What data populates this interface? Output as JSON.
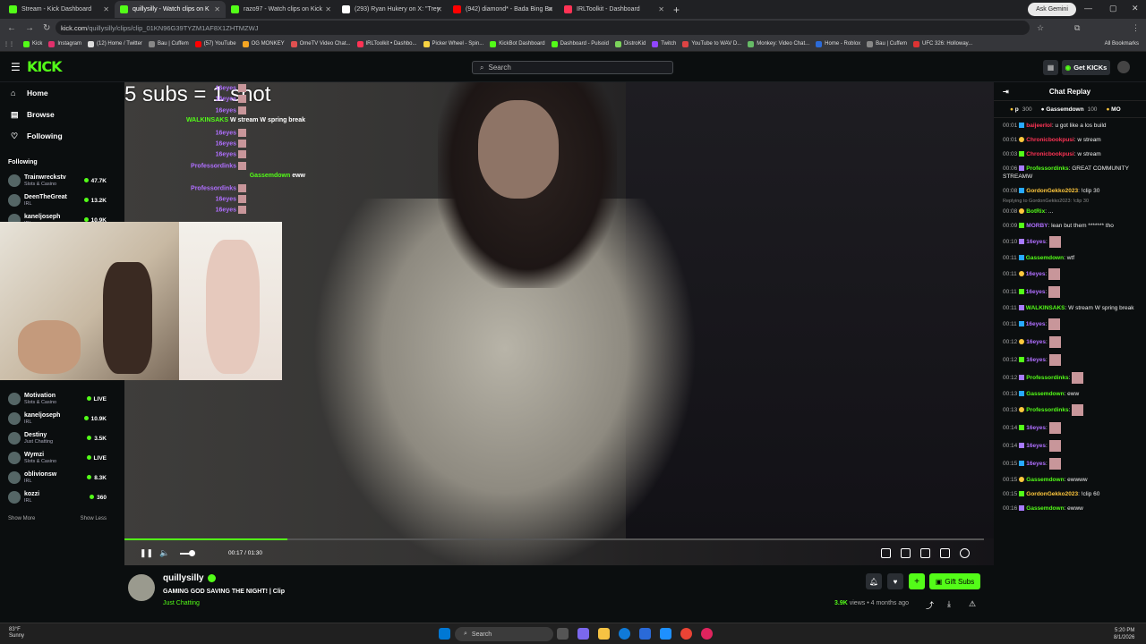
{
  "browser": {
    "tabs": [
      {
        "title": "Stream - Kick Dashboard",
        "color": "#53fc18",
        "active": false
      },
      {
        "title": "quillysilly - Watch clips on K",
        "color": "#53fc18",
        "active": true
      },
      {
        "title": "razo97 - Watch clips on Kick",
        "color": "#53fc18",
        "active": false
      },
      {
        "title": "(293) Ryan Hukery on X: \"Trey",
        "color": "#ffffff",
        "active": false
      },
      {
        "title": "(942) diamond* - Bada Bing Ba",
        "color": "#ff0000",
        "active": false
      },
      {
        "title": "IRLToolkit - Dashboard",
        "color": "#ff3355",
        "active": false
      }
    ],
    "ask_gemini": "Ask Gemini",
    "url_host": "kick.com",
    "url_path": "/quillysilly/clips/clip_01KN96G39TYZM1AF8X1ZHTMZWJ",
    "bookmarks": [
      "Kick",
      "Instagram",
      "(12) Home / Twitter",
      "Bau | Cuffem",
      "(57) YouTube",
      "OG MONKEY",
      "OmeTV Video Chat...",
      "IRLToolkit • Dashbo...",
      "Picker Wheel - Spin...",
      "KickBot Dashboard",
      "Dashboard - Pulsoid",
      "DistroKid",
      "Twitch",
      "YouTube to WAV D...",
      "Monkey: Video Chat...",
      "Home - Roblox",
      "Bau | Cuffem",
      "UFC 326: Holloway..."
    ],
    "all_bookmarks": "All Bookmarks"
  },
  "kick": {
    "logo": "KICK",
    "search_placeholder": "Search",
    "get_kicks": "Get KICKs",
    "nav": [
      {
        "label": "Home",
        "icon": "⌂"
      },
      {
        "label": "Browse",
        "icon": "▤"
      },
      {
        "label": "Following",
        "icon": "♡"
      }
    ],
    "following_heading": "Following",
    "channels": [
      {
        "name": "Trainwreckstv",
        "cat": "Slots & Casino",
        "viewers": "47.7K"
      },
      {
        "name": "DeenTheGreat",
        "cat": "IRL",
        "viewers": "13.2K"
      },
      {
        "name": "kaneljoseph",
        "cat": "IRL",
        "viewers": "10.9K"
      }
    ],
    "channels_lower": [
      {
        "name": "Motivation",
        "cat": "Slots & Casino",
        "viewers": "LIVE"
      },
      {
        "name": "kaneljoseph",
        "cat": "IRL",
        "viewers": "10.9K"
      },
      {
        "name": "Destiny",
        "cat": "Just Chatting",
        "viewers": "3.5K"
      },
      {
        "name": "Wymzi",
        "cat": "Slots & Casino",
        "viewers": "LIVE"
      },
      {
        "name": "oblivionsw",
        "cat": "IRL",
        "viewers": "8.3K"
      },
      {
        "name": "kozzi",
        "cat": "IRL",
        "viewers": "360"
      }
    ],
    "show_more": "Show More",
    "show_less": "Show Less"
  },
  "player": {
    "overlay_title": "5 subs = 1 shot",
    "overlay_chat": [
      {
        "user": "16eyes",
        "text": "",
        "green": false
      },
      {
        "user": "16eyes",
        "text": "",
        "green": false
      },
      {
        "user": "16eyes",
        "text": "",
        "green": false
      },
      {
        "user": "WALKINSAKS",
        "text": "W stream W spring break",
        "green": true
      },
      {
        "user": "16eyes",
        "text": "",
        "green": false
      },
      {
        "user": "16eyes",
        "text": "",
        "green": false
      },
      {
        "user": "16eyes",
        "text": "",
        "green": false
      },
      {
        "user": "Professordinks",
        "text": "",
        "green": false
      },
      {
        "user": "Gassemdown",
        "text": "eww",
        "green": true
      },
      {
        "user": "Professordinks",
        "text": "",
        "green": false
      },
      {
        "user": "16eyes",
        "text": "",
        "green": false
      },
      {
        "user": "16eyes",
        "text": "",
        "green": false
      }
    ],
    "time_current": "00:17",
    "time_total": "01:30",
    "progress": 0.19
  },
  "chat": {
    "title": "Chat Replay",
    "pinned": [
      {
        "label": "p",
        "value": "300"
      },
      {
        "label": "Gassemdown",
        "value": "100"
      },
      {
        "label": "MO",
        "value": ""
      }
    ],
    "messages": [
      {
        "t": "00:01",
        "user": "baijeerIol",
        "color": "#ff3355",
        "text": "u got like a los build",
        "emote": false
      },
      {
        "t": "00:01",
        "user": "Chronicbookpusi",
        "color": "#ff3355",
        "text": "w stream",
        "emote": false
      },
      {
        "t": "00:03",
        "user": "Chronicbookpusi",
        "color": "#ff3355",
        "text": "w stream",
        "emote": false
      },
      {
        "t": "00:06",
        "user": "Professordinks",
        "color": "#53fc18",
        "text": "GREAT COMMUNITY STREAMW",
        "emote": false
      },
      {
        "t": "00:08",
        "user": "GordonGekko2023",
        "color": "#ffc83d",
        "text": "!clip 30",
        "emote": false
      },
      {
        "t": "00:08",
        "user": "BotRix",
        "color": "#53fc18",
        "text": "...",
        "emote": false,
        "reply": "Replying to GordonGekko2023: !clip 30"
      },
      {
        "t": "00:09",
        "user": "MORBY",
        "color": "#b06fff",
        "text": "lean but them ******* tho",
        "emote": false
      },
      {
        "t": "00:10",
        "user": "16eyes",
        "color": "#b06fff",
        "text": "",
        "emote": true
      },
      {
        "t": "00:11",
        "user": "Gassemdown",
        "color": "#53fc18",
        "text": "wtf",
        "emote": false
      },
      {
        "t": "00:11",
        "user": "16eyes",
        "color": "#b06fff",
        "text": "",
        "emote": true
      },
      {
        "t": "00:11",
        "user": "16eyes",
        "color": "#b06fff",
        "text": "",
        "emote": true
      },
      {
        "t": "00:11",
        "user": "WALKINSAKS",
        "color": "#53fc18",
        "text": "W stream W spring break",
        "emote": false
      },
      {
        "t": "00:11",
        "user": "16eyes",
        "color": "#b06fff",
        "text": "",
        "emote": true
      },
      {
        "t": "00:12",
        "user": "16eyes",
        "color": "#b06fff",
        "text": "",
        "emote": true
      },
      {
        "t": "00:12",
        "user": "16eyes",
        "color": "#b06fff",
        "text": "",
        "emote": true
      },
      {
        "t": "00:12",
        "user": "Professordinks",
        "color": "#53fc18",
        "text": "",
        "emote": true
      },
      {
        "t": "00:13",
        "user": "Gassemdown",
        "color": "#53fc18",
        "text": "eww",
        "emote": false
      },
      {
        "t": "00:13",
        "user": "Professordinks",
        "color": "#53fc18",
        "text": "",
        "emote": true
      },
      {
        "t": "00:14",
        "user": "16eyes",
        "color": "#b06fff",
        "text": "",
        "emote": true
      },
      {
        "t": "00:14",
        "user": "16eyes",
        "color": "#b06fff",
        "text": "",
        "emote": true
      },
      {
        "t": "00:15",
        "user": "16eyes",
        "color": "#b06fff",
        "text": "",
        "emote": true
      },
      {
        "t": "00:15",
        "user": "Gassemdown",
        "color": "#53fc18",
        "text": "ewwww",
        "emote": false
      },
      {
        "t": "00:15",
        "user": "GordonGekko2023",
        "color": "#ffc83d",
        "text": "!clip 60",
        "emote": false
      },
      {
        "t": "00:16",
        "user": "Gassemdown",
        "color": "#53fc18",
        "text": "ewww",
        "emote": false
      }
    ]
  },
  "clip": {
    "channel": "quillysilly",
    "title": "GAMING GOD SAVING THE NIGHT! | Clip",
    "category": "Just Chatting",
    "views": "3.9K",
    "views_label": "views",
    "age": "• 4 months ago",
    "gift_subs": "Gift Subs"
  },
  "taskbar": {
    "temp": "83°F",
    "weather": "Sunny",
    "search": "Search",
    "time": "5:20 PM",
    "date": "8/1/2026"
  }
}
